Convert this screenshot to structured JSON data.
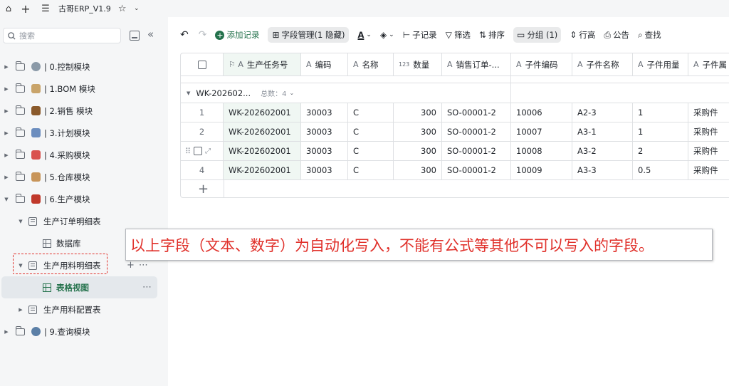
{
  "topbar": {
    "title": "古哥ERP_V1.9"
  },
  "sidebar": {
    "search_placeholder": "搜索",
    "items": [
      {
        "label": "| 0.控制模块",
        "emoji": "gear-emoji",
        "color": "#8b9aa8"
      },
      {
        "label": "| 1.BOM 模块",
        "emoji": "clipboard-emoji",
        "color": "#c9a46a"
      },
      {
        "label": "| 2.销售 模块",
        "emoji": "briefcase-emoji",
        "color": "#8a5a2b"
      },
      {
        "label": "| 3.计划模块",
        "emoji": "calendar-emoji",
        "color": "#6c8ebf"
      },
      {
        "label": "| 4.采购模块",
        "emoji": "cart-emoji",
        "color": "#d9534f"
      },
      {
        "label": "| 5.仓库模块",
        "emoji": "package-emoji",
        "color": "#c8955a"
      },
      {
        "label": "| 6.生产模块",
        "emoji": "book-emoji",
        "color": "#c0392b"
      }
    ],
    "sub": {
      "order_table": "生产订单明细表",
      "database": "数据库",
      "material_table": "生产用料明细表",
      "grid_view": "表格视图",
      "config_table": "生产用料配置表"
    },
    "query_module": {
      "label": "| 9.查询模块",
      "emoji": "magnifier-emoji",
      "color": "#5b7fa6"
    }
  },
  "toolbar": {
    "add_record": "添加记录",
    "field_manage": "字段管理(1 隐藏)",
    "sub_record": "子记录",
    "filter": "筛选",
    "sort": "排序",
    "group": "分组 (1)",
    "row_height": "行高",
    "notice": "公告",
    "find": "查找"
  },
  "table": {
    "headers": {
      "task": "生产任务号",
      "code": "编码",
      "name": "名称",
      "qty": "数量",
      "so": "销售订单-...",
      "part_code": "子件编码",
      "part_name": "子件名称",
      "part_qty": "子件用量",
      "part_attr": "子件属"
    },
    "group": {
      "label": "WK-202602...",
      "total": "总数：4"
    },
    "rows": [
      {
        "no": "1",
        "task": "WK-202602001",
        "code": "30003",
        "name": "C",
        "qty": "300",
        "so": "SO-00001-2",
        "part_code": "10006",
        "part_name": "A2-3",
        "part_qty": "1",
        "part_attr": "采购件"
      },
      {
        "no": "2",
        "task": "WK-202602001",
        "code": "30003",
        "name": "C",
        "qty": "300",
        "so": "SO-00001-2",
        "part_code": "10007",
        "part_name": "A3-1",
        "part_qty": "1",
        "part_attr": "采购件"
      },
      {
        "no": "",
        "task": "WK-202602001",
        "code": "30003",
        "name": "C",
        "qty": "300",
        "so": "SO-00001-2",
        "part_code": "10008",
        "part_name": "A3-2",
        "part_qty": "2",
        "part_attr": "采购件"
      },
      {
        "no": "4",
        "task": "WK-202602001",
        "code": "30003",
        "name": "C",
        "qty": "300",
        "so": "SO-00001-2",
        "part_code": "10009",
        "part_name": "A3-3",
        "part_qty": "0.5",
        "part_attr": "采购件"
      }
    ]
  },
  "callout": {
    "text": "以上字段（文本、数字）为自动化写入，不能有公式等其他不可以写入的字段。",
    "color": "#e0302a"
  },
  "colors": {
    "accent": "#24724c",
    "annotation": "#e0302a"
  }
}
